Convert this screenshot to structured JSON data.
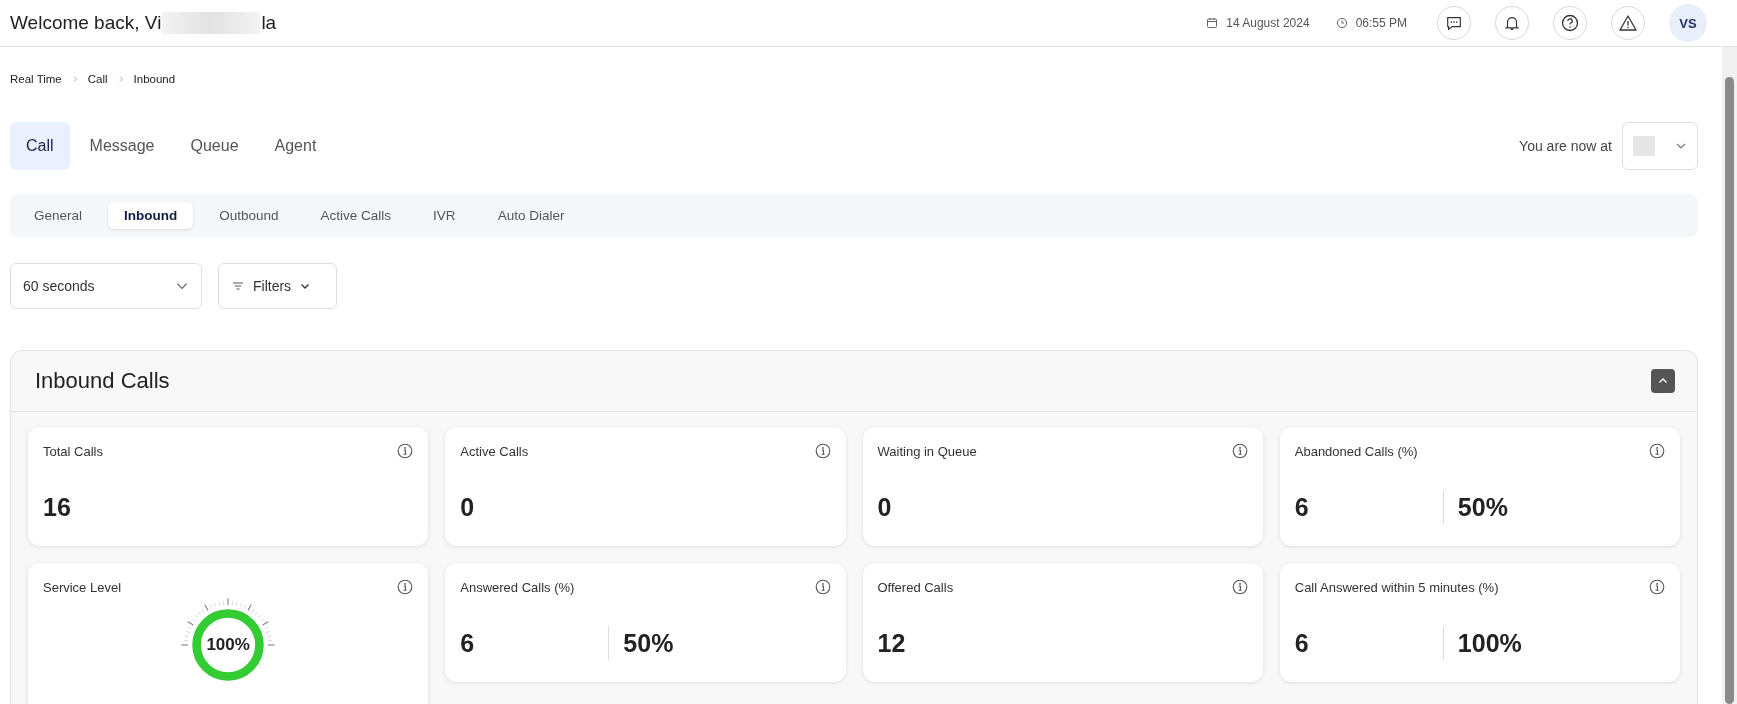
{
  "header": {
    "greeting_start": "Welcome back, Vi",
    "greeting_end": "la",
    "date": "14 August 2024",
    "time": "06:55 PM",
    "avatar_initials": "VS"
  },
  "breadcrumb": [
    "Real Time",
    "Call",
    "Inbound"
  ],
  "tabs": [
    {
      "label": "Call",
      "selected": true
    },
    {
      "label": "Message",
      "selected": false
    },
    {
      "label": "Queue",
      "selected": false
    },
    {
      "label": "Agent",
      "selected": false
    }
  ],
  "location": {
    "label": "You are now at"
  },
  "subtabs": [
    {
      "label": "General",
      "selected": false
    },
    {
      "label": "Inbound",
      "selected": true
    },
    {
      "label": "Outbound",
      "selected": false
    },
    {
      "label": "Active Calls",
      "selected": false
    },
    {
      "label": "IVR",
      "selected": false
    },
    {
      "label": "Auto Dialer",
      "selected": false
    }
  ],
  "interval": {
    "value": "60 seconds"
  },
  "filters": {
    "label": "Filters"
  },
  "panel": {
    "title": "Inbound Calls",
    "expanded": true,
    "cards": [
      {
        "kind": "single",
        "title": "Total Calls",
        "value": "16"
      },
      {
        "kind": "single",
        "title": "Active Calls",
        "value": "0"
      },
      {
        "kind": "single",
        "title": "Waiting in Queue",
        "value": "0"
      },
      {
        "kind": "split",
        "title": "Abandoned Calls (%)",
        "count": "6",
        "percent": "50%"
      },
      {
        "kind": "gauge",
        "title": "Service Level",
        "level": 1,
        "reading": "100%"
      },
      {
        "kind": "split",
        "title": "Answered Calls (%)",
        "count": "6",
        "percent": "50%"
      },
      {
        "kind": "single",
        "title": "Offered Calls",
        "value": "12"
      },
      {
        "kind": "split",
        "title": "Call Answered within 5 minutes (%)",
        "count": "6",
        "percent": "100%"
      }
    ]
  }
}
